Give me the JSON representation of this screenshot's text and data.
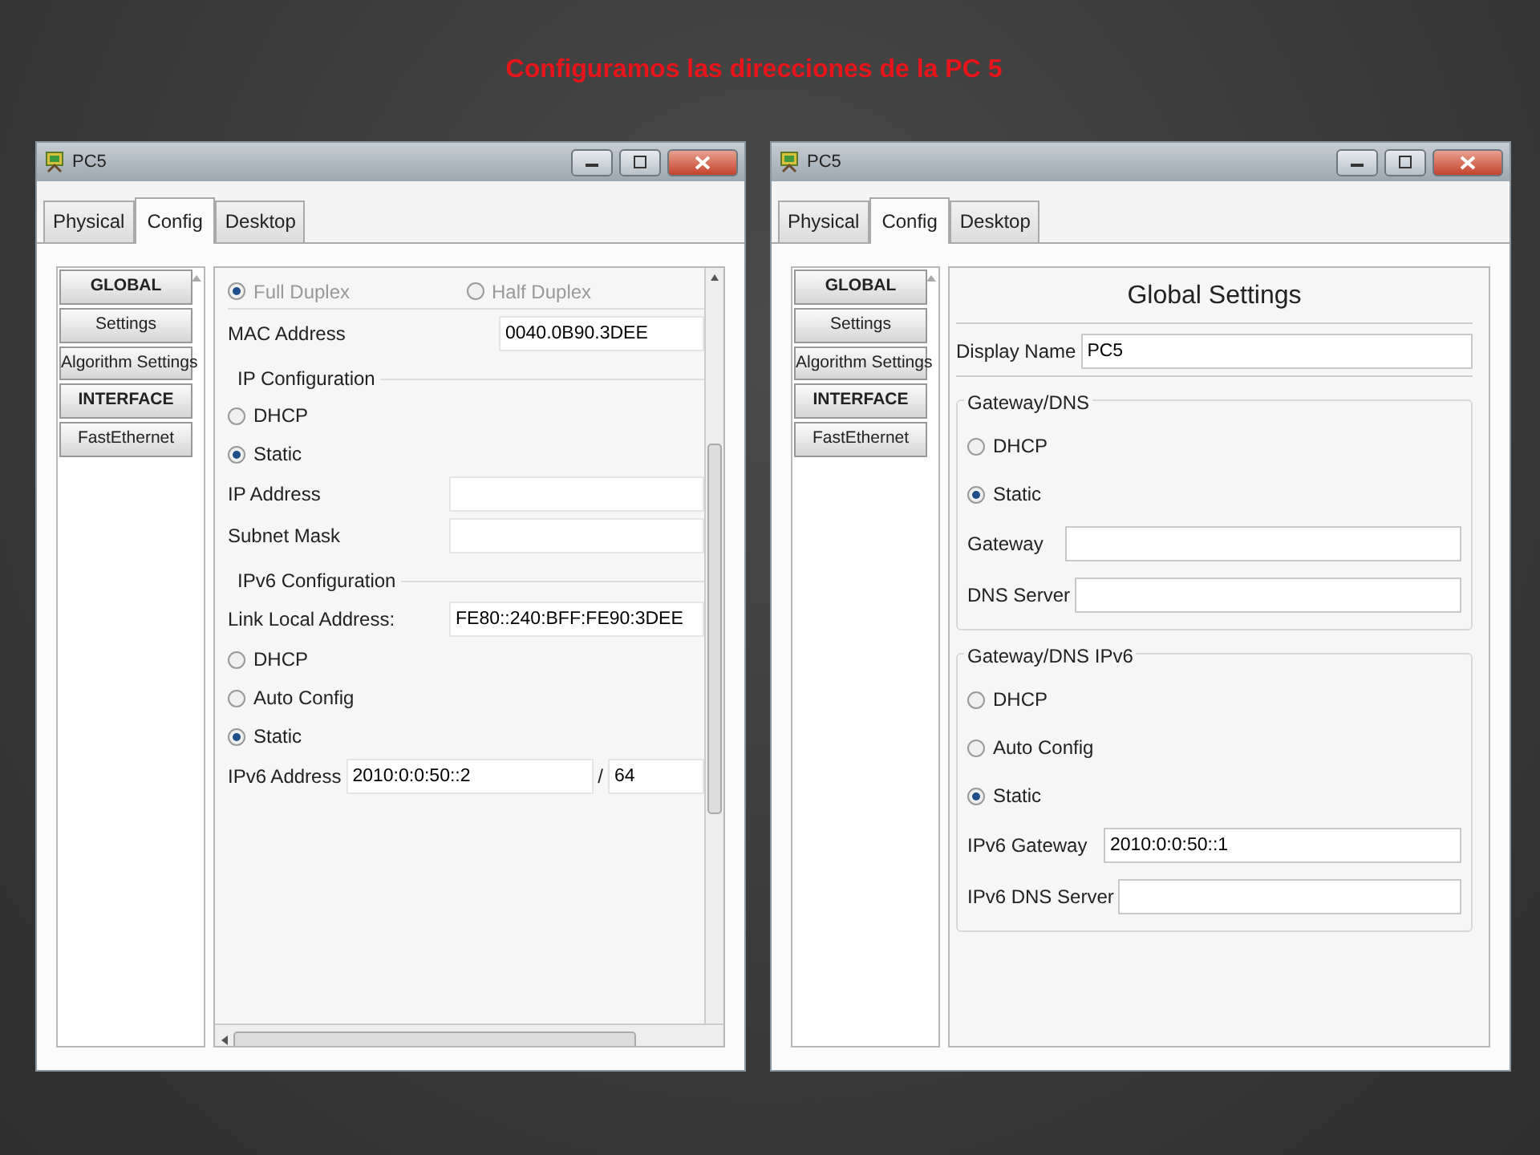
{
  "heading": "Configuramos  las direcciones  de la PC 5",
  "windows": [
    {
      "title": "PC5",
      "tabs": [
        {
          "label": "Physical",
          "selected": false
        },
        {
          "label": "Config",
          "selected": true
        },
        {
          "label": "Desktop",
          "selected": false
        }
      ],
      "sidebar": [
        {
          "label": "GLOBAL",
          "kind": "header"
        },
        {
          "label": "Settings",
          "kind": "item"
        },
        {
          "label": "Algorithm Settings",
          "kind": "item"
        },
        {
          "label": "INTERFACE",
          "kind": "header"
        },
        {
          "label": "FastEthernet",
          "kind": "item"
        }
      ],
      "panel": {
        "scrollable": true,
        "rows": [
          {
            "kind": "radio_pair",
            "disabled": true,
            "options": [
              {
                "label": "Full Duplex",
                "selected": true
              },
              {
                "label": "Half Duplex",
                "selected": false
              }
            ]
          },
          {
            "kind": "field",
            "label": "MAC Address",
            "value": "0040.0B90.3DEE"
          },
          {
            "kind": "section",
            "title": "IP Configuration",
            "rows": [
              {
                "kind": "radio",
                "label": "DHCP",
                "selected": false
              },
              {
                "kind": "radio",
                "label": "Static",
                "selected": true
              },
              {
                "kind": "field",
                "label": "IP Address"
              },
              {
                "kind": "field",
                "label": "Subnet Mask"
              }
            ]
          },
          {
            "kind": "section",
            "title": "IPv6 Configuration",
            "rows": [
              {
                "kind": "field",
                "label": "Link Local Address:",
                "value": "FE80::240:BFF:FE90:3DEE"
              },
              {
                "kind": "radio",
                "label": "DHCP",
                "selected": false
              },
              {
                "kind": "radio",
                "label": "Auto Config",
                "selected": false
              },
              {
                "kind": "radio",
                "label": "Static",
                "selected": true
              },
              {
                "kind": "prefix_field",
                "label": "IPv6 Address",
                "value": "2010:0:0:50::2",
                "separator": "/",
                "prefix": "64"
              }
            ]
          }
        ]
      }
    },
    {
      "title": "PC5",
      "tabs": [
        {
          "label": "Physical",
          "selected": false
        },
        {
          "label": "Config",
          "selected": true
        },
        {
          "label": "Desktop",
          "selected": false
        }
      ],
      "sidebar": [
        {
          "label": "GLOBAL",
          "kind": "header"
        },
        {
          "label": "Settings",
          "kind": "item"
        },
        {
          "label": "Algorithm Settings",
          "kind": "item"
        },
        {
          "label": "INTERFACE",
          "kind": "header"
        },
        {
          "label": "FastEthernet",
          "kind": "item"
        }
      ],
      "panel": {
        "scrollable": false,
        "rows": [
          {
            "kind": "heading",
            "label": "Global Settings"
          },
          {
            "kind": "field",
            "label": "Display Name",
            "value": "PC5"
          },
          {
            "kind": "group",
            "title": "Gateway/DNS",
            "rows": [
              {
                "kind": "radio",
                "label": "DHCP",
                "selected": false
              },
              {
                "kind": "radio",
                "label": "Static",
                "selected": true
              },
              {
                "kind": "field",
                "label": "Gateway"
              },
              {
                "kind": "field",
                "label": "DNS Server"
              }
            ]
          },
          {
            "kind": "group",
            "title": "Gateway/DNS IPv6",
            "rows": [
              {
                "kind": "radio",
                "label": "DHCP",
                "selected": false
              },
              {
                "kind": "radio",
                "label": "Auto Config",
                "selected": false
              },
              {
                "kind": "radio",
                "label": "Static",
                "selected": true
              },
              {
                "kind": "field",
                "label": "IPv6 Gateway",
                "value": "2010:0:0:50::1"
              },
              {
                "kind": "field",
                "label": "IPv6 DNS Server"
              }
            ]
          }
        ]
      }
    }
  ]
}
